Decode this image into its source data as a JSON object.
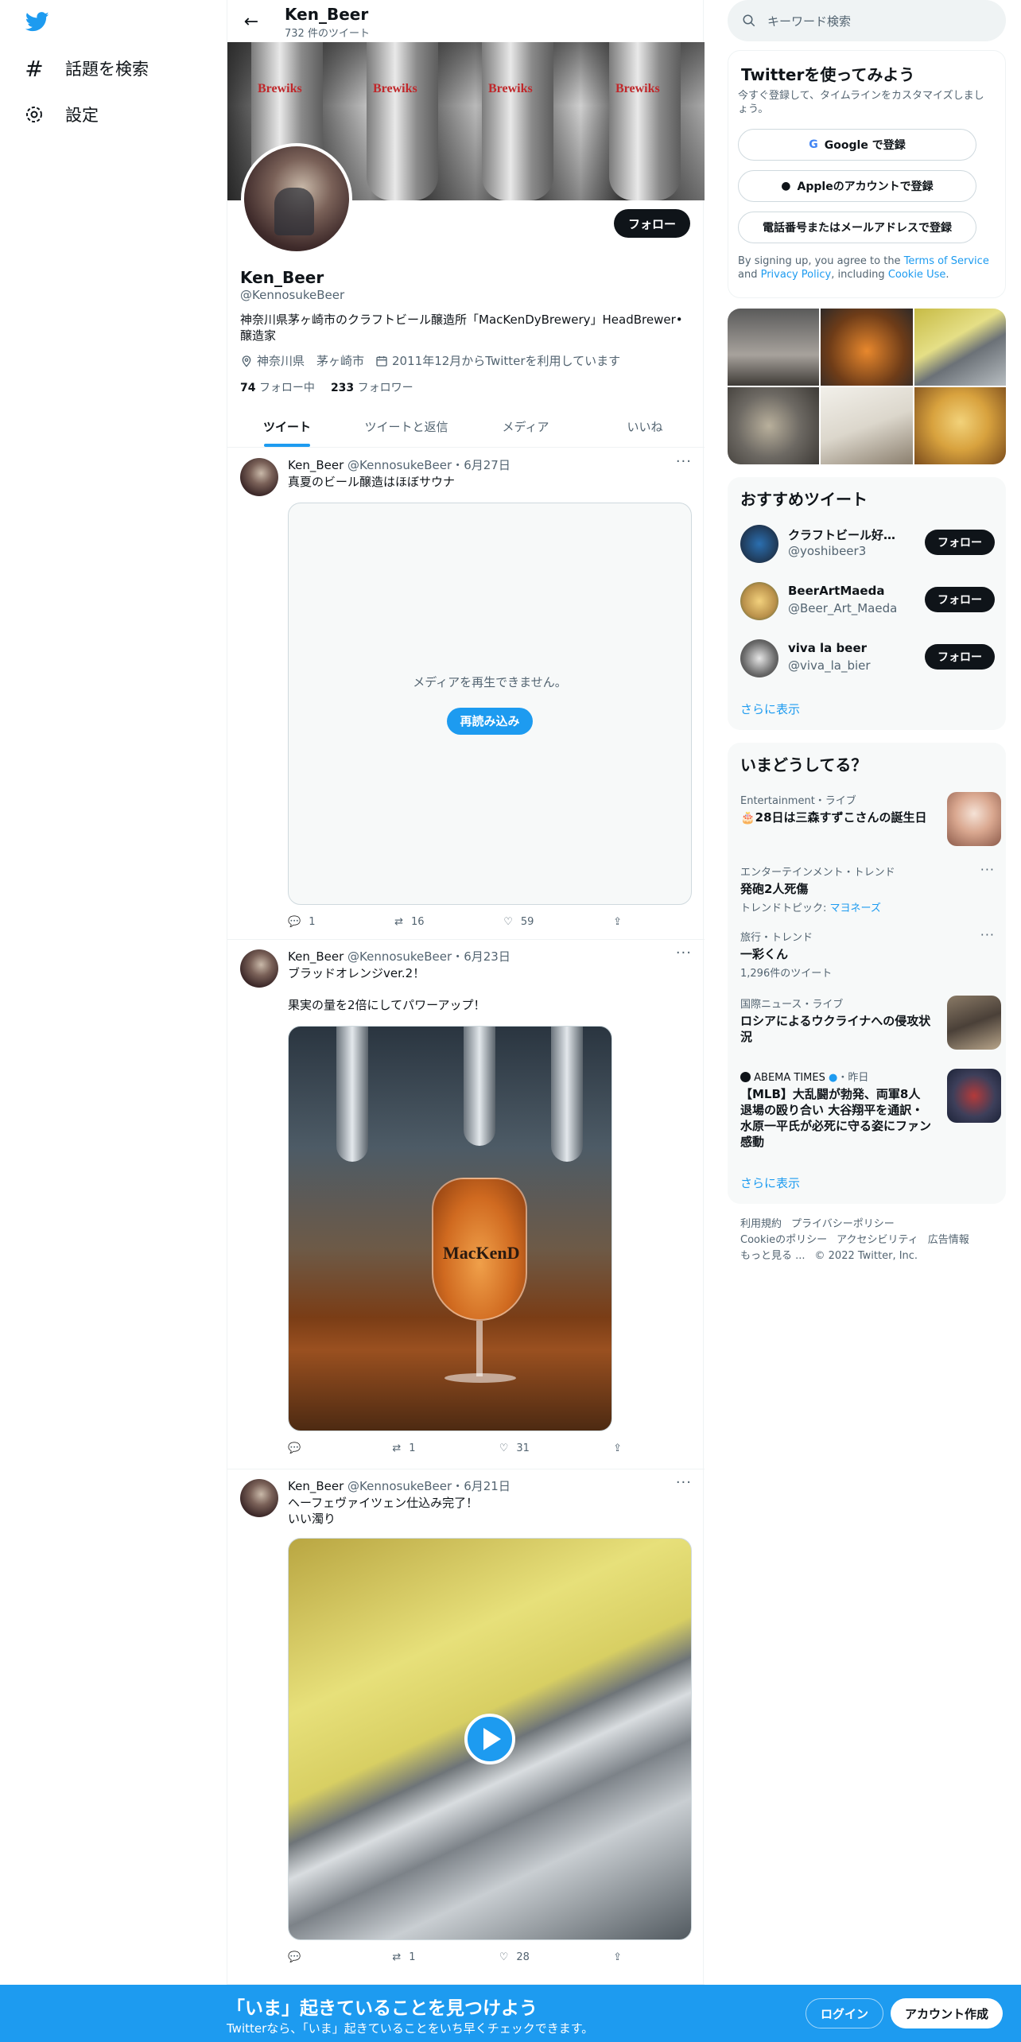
{
  "nav": {
    "logo": "twitter-bird-icon",
    "items": [
      {
        "label": "話題を検索",
        "icon": "hashtag-icon"
      },
      {
        "label": "設定",
        "icon": "gear-icon"
      }
    ]
  },
  "header": {
    "name": "Ken_Beer",
    "tweet_count": "732 件のツイート"
  },
  "banner": {
    "labels": [
      "Brewiks",
      "Brewiks",
      "Brewiks",
      "Brewiks"
    ]
  },
  "profile": {
    "follow_label": "フォロー",
    "name": "Ken_Beer",
    "handle": "@KennosukeBeer",
    "bio": "神奈川県茅ヶ崎市のクラフトビール醸造所「MacKenDyBrewery」HeadBrewer•醸造家",
    "location": "神奈川県　茅ヶ崎市",
    "joined": "2011年12月からTwitterを利用しています",
    "following_count": "74",
    "following_label": "フォロー中",
    "followers_count": "233",
    "followers_label": "フォロワー"
  },
  "tabs": [
    {
      "label": "ツイート",
      "active": true
    },
    {
      "label": "ツイートと返信",
      "active": false
    },
    {
      "label": "メディア",
      "active": false
    },
    {
      "label": "いいね",
      "active": false
    }
  ],
  "tweets": [
    {
      "name": "Ken_Beer",
      "handle": "@KennosukeBeer",
      "date": "6月27日",
      "text": "真夏のビール醸造はほぼサウナ",
      "media_error": "メディアを再生できません。",
      "retry_label": "再読み込み",
      "replies": "1",
      "retweets": "16",
      "likes": "59"
    },
    {
      "name": "Ken_Beer",
      "handle": "@KennosukeBeer",
      "date": "6月23日",
      "text": "ブラッドオレンジver.2！\n\n果実の量を2倍にしてパワーアップ！",
      "glass_logo": "MacKenD",
      "replies": "",
      "retweets": "1",
      "likes": "31"
    },
    {
      "name": "Ken_Beer",
      "handle": "@KennosukeBeer",
      "date": "6月21日",
      "text": "ヘーフェヴァイツェン仕込み完了！\nいい濁り",
      "replies": "",
      "retweets": "1",
      "likes": "28"
    }
  ],
  "search": {
    "placeholder": "キーワード検索"
  },
  "signup": {
    "title": "Twitterを使ってみよう",
    "desc": "今すぐ登録して、タイムラインをカスタマイズしましょう。",
    "google": "Google で登録",
    "apple": "Appleのアカウントで登録",
    "phone": "電話番号またはメールアドレスで登録",
    "terms_prefix": "By signing up, you agree to the ",
    "terms": "Terms of Service",
    "and": " and ",
    "privacy": "Privacy Policy",
    "including": ", including ",
    "cookie": "Cookie Use",
    "period": "."
  },
  "recommended": {
    "title": "おすすめツイート",
    "users": [
      {
        "name": "クラフトビール好き...",
        "handle": "@yoshibeer3",
        "follow": "フォロー"
      },
      {
        "name": "BeerArtMaeda",
        "handle": "@Beer_Art_Maeda",
        "follow": "フォロー"
      },
      {
        "name": "viva la beer",
        "handle": "@viva_la_bier",
        "follow": "フォロー"
      }
    ],
    "more": "さらに表示"
  },
  "trends": {
    "title": "いまどうしてる？",
    "items": [
      {
        "meta": "Entertainment・ライブ",
        "title": "🎂28日は三森すずこさんの誕生日",
        "sub": ""
      },
      {
        "meta": "エンターテインメント・トレンド",
        "title": "発砲2人死傷",
        "sub": "トレンドトピック: ",
        "sub_link": "マヨネーズ"
      },
      {
        "meta": "旅行・トレンド",
        "title": "一彩くん",
        "sub": "1,296件のツイート"
      },
      {
        "meta": "国際ニュース・ライブ",
        "title": "ロシアによるウクライナへの侵攻状況",
        "sub": ""
      },
      {
        "meta": "ABEMA TIMES",
        "meta_time": "・昨日",
        "title": "【MLB】大乱闘が勃発、両軍8人退場の殴り合い 大谷翔平を通訳・水原一平氏が必死に守る姿にファン感動",
        "sub": ""
      }
    ],
    "more": "さらに表示"
  },
  "footer": {
    "links": [
      "利用規約",
      "プライバシーポリシー",
      "Cookieのポリシー",
      "アクセシビリティ",
      "広告情報",
      "もっと見る ..."
    ],
    "copyright": "© 2022 Twitter, Inc."
  },
  "bottom": {
    "title": "「いま」起きていることを見つけよう",
    "sub": "Twitterなら、「いま」起きていることをいち早くチェックできます。",
    "login": "ログイン",
    "signup": "アカウント作成"
  },
  "colors": {
    "accent": "#1d9bf0",
    "text": "#0f1419",
    "secondary": "#536471"
  }
}
